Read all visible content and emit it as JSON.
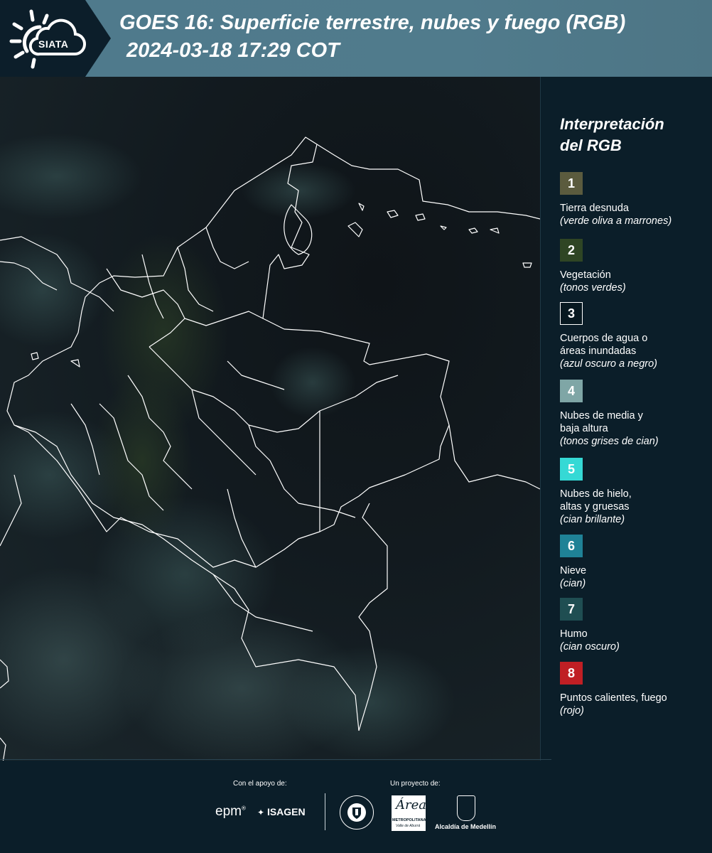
{
  "header": {
    "logo_text": "SIATA",
    "title": "GOES 16: Superficie terrestre, nubes y fuego (RGB)",
    "subtitle": "2024-03-18 17:29 COT"
  },
  "legend": {
    "title_line1": "Interpretación",
    "title_line2": "del RGB",
    "items": [
      {
        "num": "1",
        "color": "#5b5b3e",
        "label_lines": [
          "Tierra desnuda"
        ],
        "sub": "(verde oliva a marrones)"
      },
      {
        "num": "2",
        "color": "#2f4524",
        "label_lines": [
          "Vegetación"
        ],
        "sub": "(tonos verdes)"
      },
      {
        "num": "3",
        "color": "#071820",
        "label_lines": [
          "Cuerpos de agua o",
          "áreas inundadas"
        ],
        "sub": "(azul oscuro a negro)"
      },
      {
        "num": "4",
        "color": "#7fa6a6",
        "label_lines": [
          "Nubes de media y",
          "baja altura"
        ],
        "sub": "(tonos grises de cian)"
      },
      {
        "num": "5",
        "color": "#35d9d5",
        "label_lines": [
          "Nubes de hielo,",
          "altas y gruesas"
        ],
        "sub": "(cian brillante)"
      },
      {
        "num": "6",
        "color": "#1f8296",
        "label_lines": [
          "Nieve"
        ],
        "sub": "(cian)"
      },
      {
        "num": "7",
        "color": "#1f4e52",
        "label_lines": [
          "Humo"
        ],
        "sub": "(cian oscuro)"
      },
      {
        "num": "8",
        "color": "#c01f24",
        "label_lines": [
          "Puntos calientes, fuego"
        ],
        "sub": "(rojo)"
      }
    ]
  },
  "footer": {
    "support_label": "Con el apoyo de:",
    "project_label": "Un proyecto de:",
    "epm": "epm",
    "isagen": "ISAGEN",
    "area_small": "METROPOLITANA",
    "area_sub": "Valle de Aburrá",
    "area_script": "Área",
    "alcaldia": "Alcaldía de Medellín"
  },
  "colors": {
    "header_band": "#507b8c",
    "background": "#0b1e29",
    "map_borders": "#ffffff"
  }
}
